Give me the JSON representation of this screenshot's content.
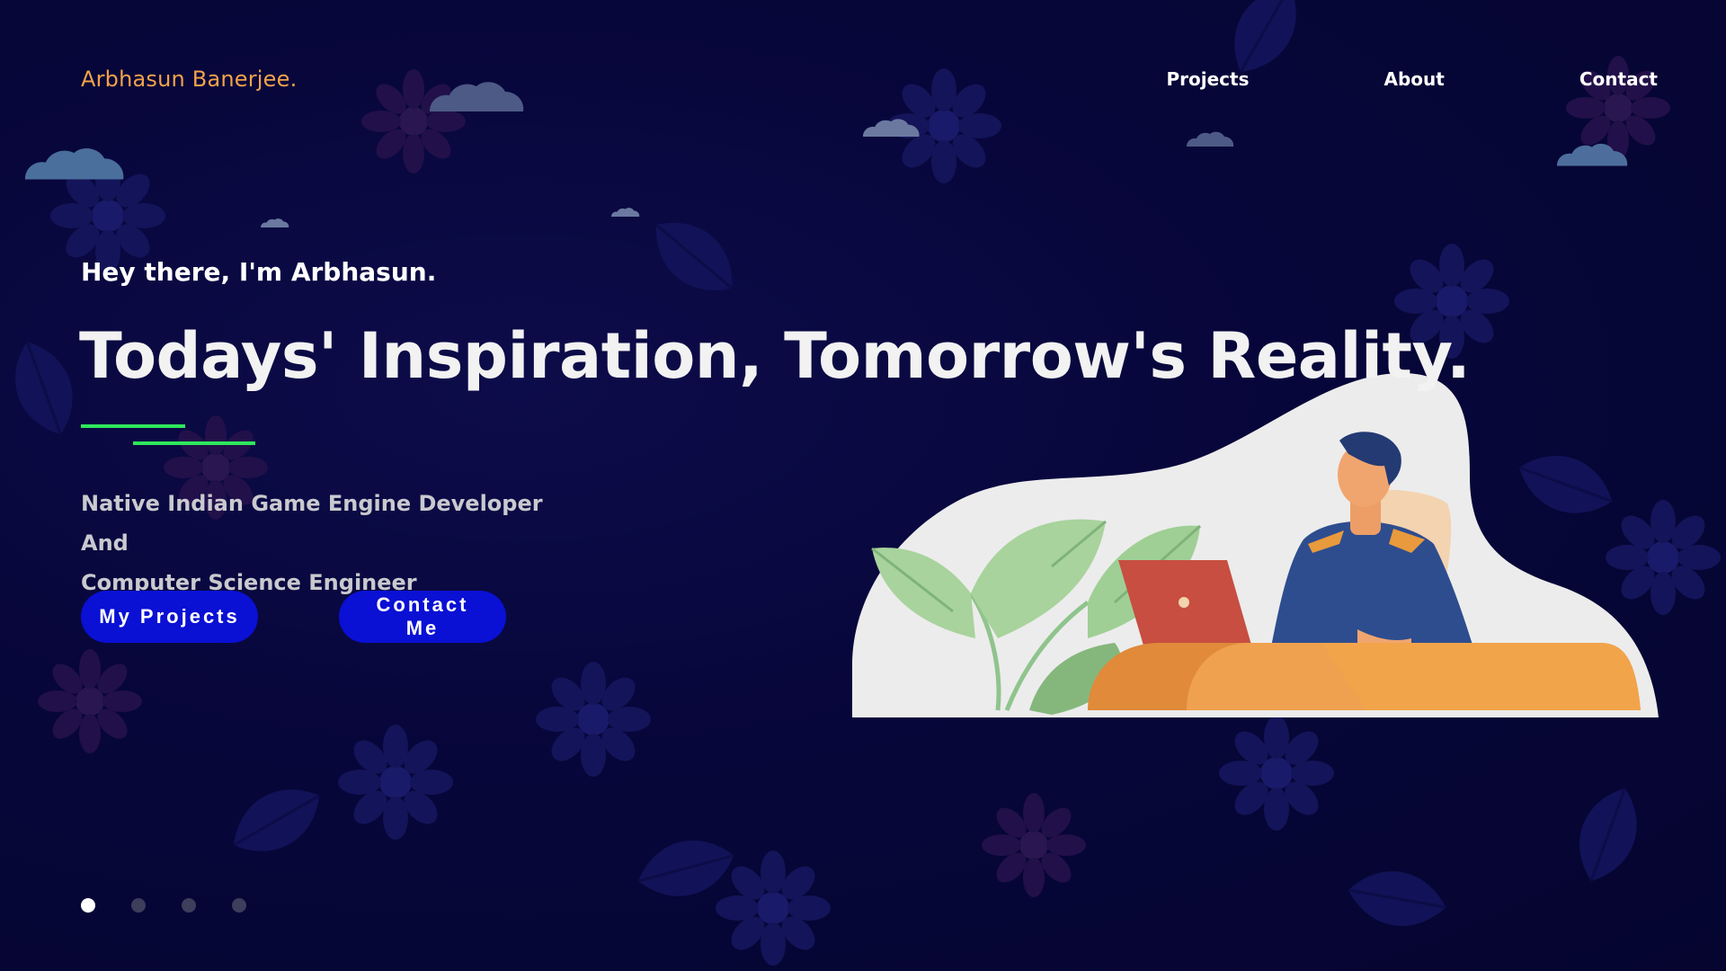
{
  "header": {
    "logo": "Arbhasun Banerjee.",
    "nav": [
      {
        "label": "Projects"
      },
      {
        "label": "About"
      },
      {
        "label": "Contact"
      }
    ]
  },
  "hero": {
    "greeting": "Hey there, I'm Arbhasun.",
    "headline": "Todays' Inspiration, Tomorrow's Reality.",
    "subtitle_line1": "Native Indian Game Engine Developer And",
    "subtitle_line2": "Computer Science Engineer",
    "primary_button": "My Projects",
    "secondary_button": "Contact Me"
  },
  "carousel": {
    "slide_count": 4,
    "active_index": 0
  },
  "colors": {
    "logo": "#f3a24a",
    "button": "#0a10d4",
    "accent_underline": "#2ee85b",
    "background": "#07063a"
  },
  "icons": {
    "clouds": "cloud-icon",
    "illustration": "developer-at-desk-illustration"
  }
}
